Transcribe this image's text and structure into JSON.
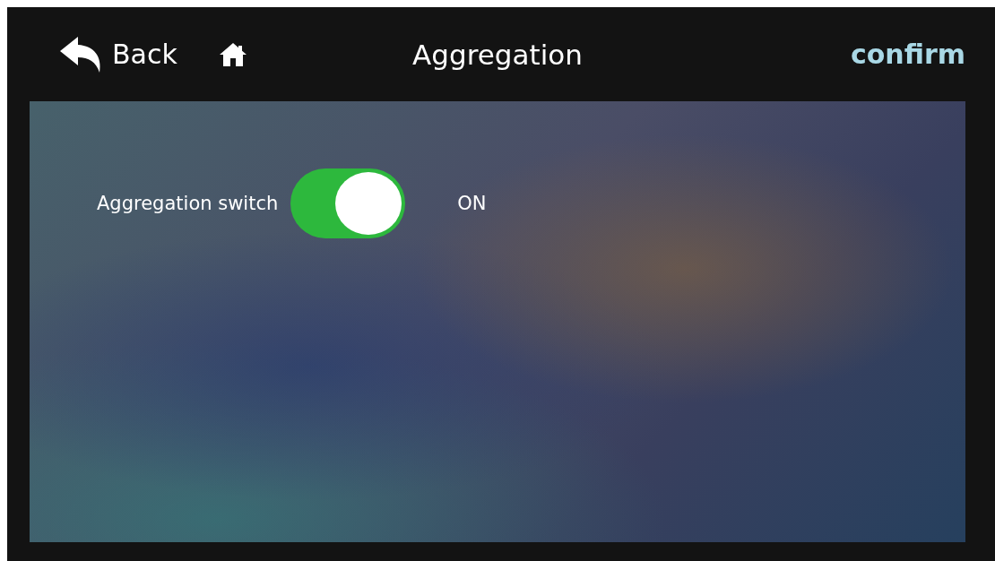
{
  "header": {
    "back_label": "Back",
    "title": "Aggregation",
    "confirm_label": "confirm"
  },
  "settings": [
    {
      "kind": "switch",
      "label": "Aggregation switch",
      "on": true,
      "state_text": "ON"
    }
  ]
}
